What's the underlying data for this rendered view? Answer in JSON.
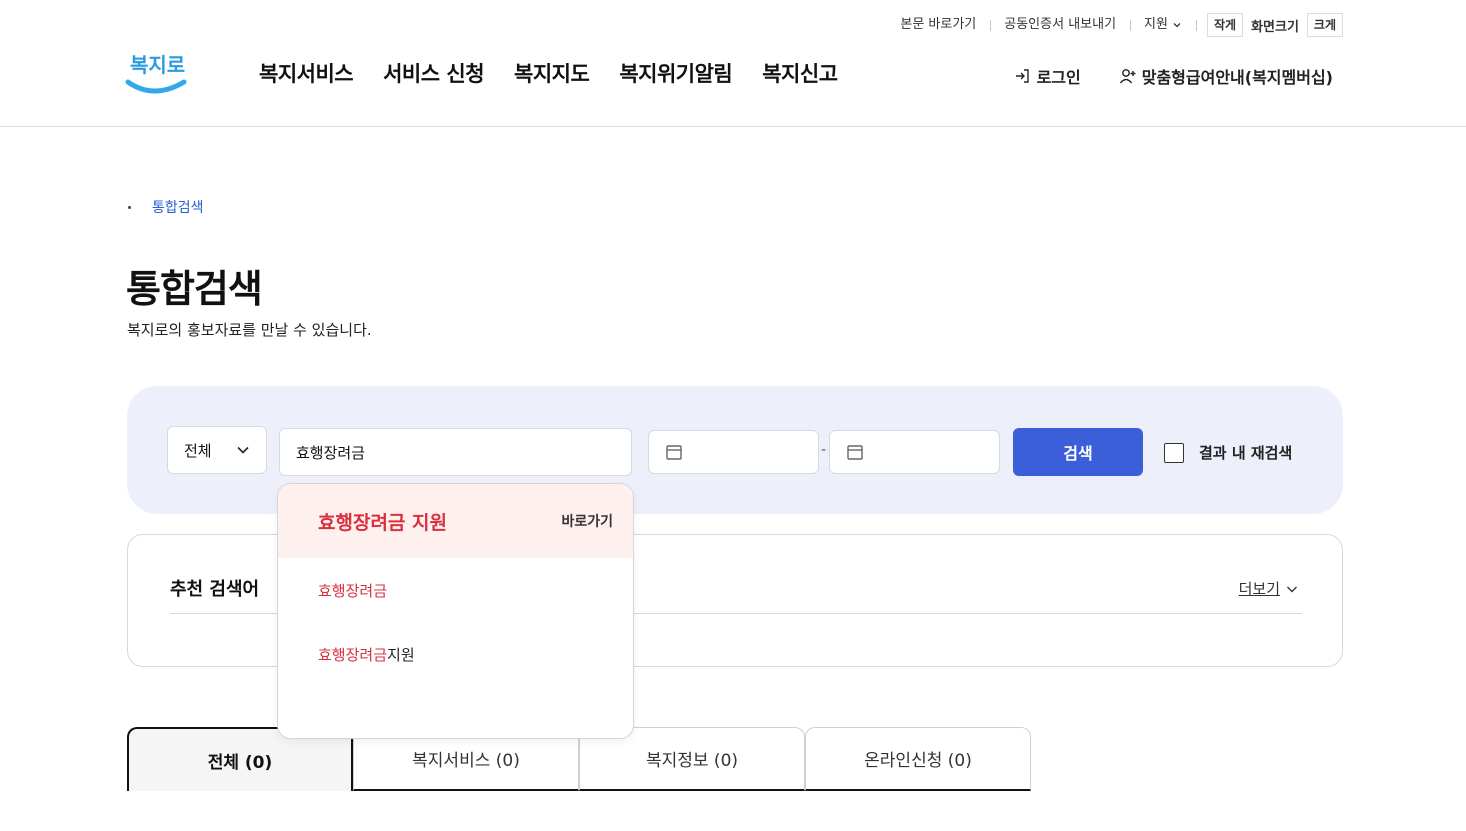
{
  "header": {
    "util_links": [
      "본문 바로가기",
      "공동인증서 내보내기"
    ],
    "lang_label": "지원",
    "font_small": "작게",
    "font_label": "화면크기",
    "font_large": "크게",
    "logo_text": "복지로",
    "gnb": [
      "복지서비스",
      "서비스 신청",
      "복지지도",
      "복지위기알림",
      "복지신고"
    ],
    "login": "로그인",
    "membership": "맞춤형급여안내(복지멤버십)"
  },
  "breadcrumb": "통합검색",
  "page": {
    "title": "통합검색",
    "desc": "복지로의 홍보자료를 만날 수 있습니다."
  },
  "search": {
    "category": "전체",
    "keyword": "효행장려금",
    "date_start": "",
    "date_end": "",
    "date_sep": "-",
    "button": "검색",
    "recheck_label": "결과 내 재검색"
  },
  "autocomplete": {
    "top": "효행장려금 지원",
    "top_action": "바로가기",
    "items": [
      {
        "hl": "효행장려금",
        "rest": ""
      },
      {
        "hl": "효행장려금",
        "rest": "지원"
      }
    ]
  },
  "reco": {
    "title": "추천 검색어",
    "more": "더보기"
  },
  "tabs": [
    "전체  (0)",
    "복지서비스 (0)",
    "복지정보 (0)",
    "온라인신청 (0)"
  ],
  "colors": {
    "accent": "#3a5fd9",
    "panel_bg": "#edf0fb",
    "highlight": "#d8313b",
    "highlight_bg": "#fff0f0"
  }
}
